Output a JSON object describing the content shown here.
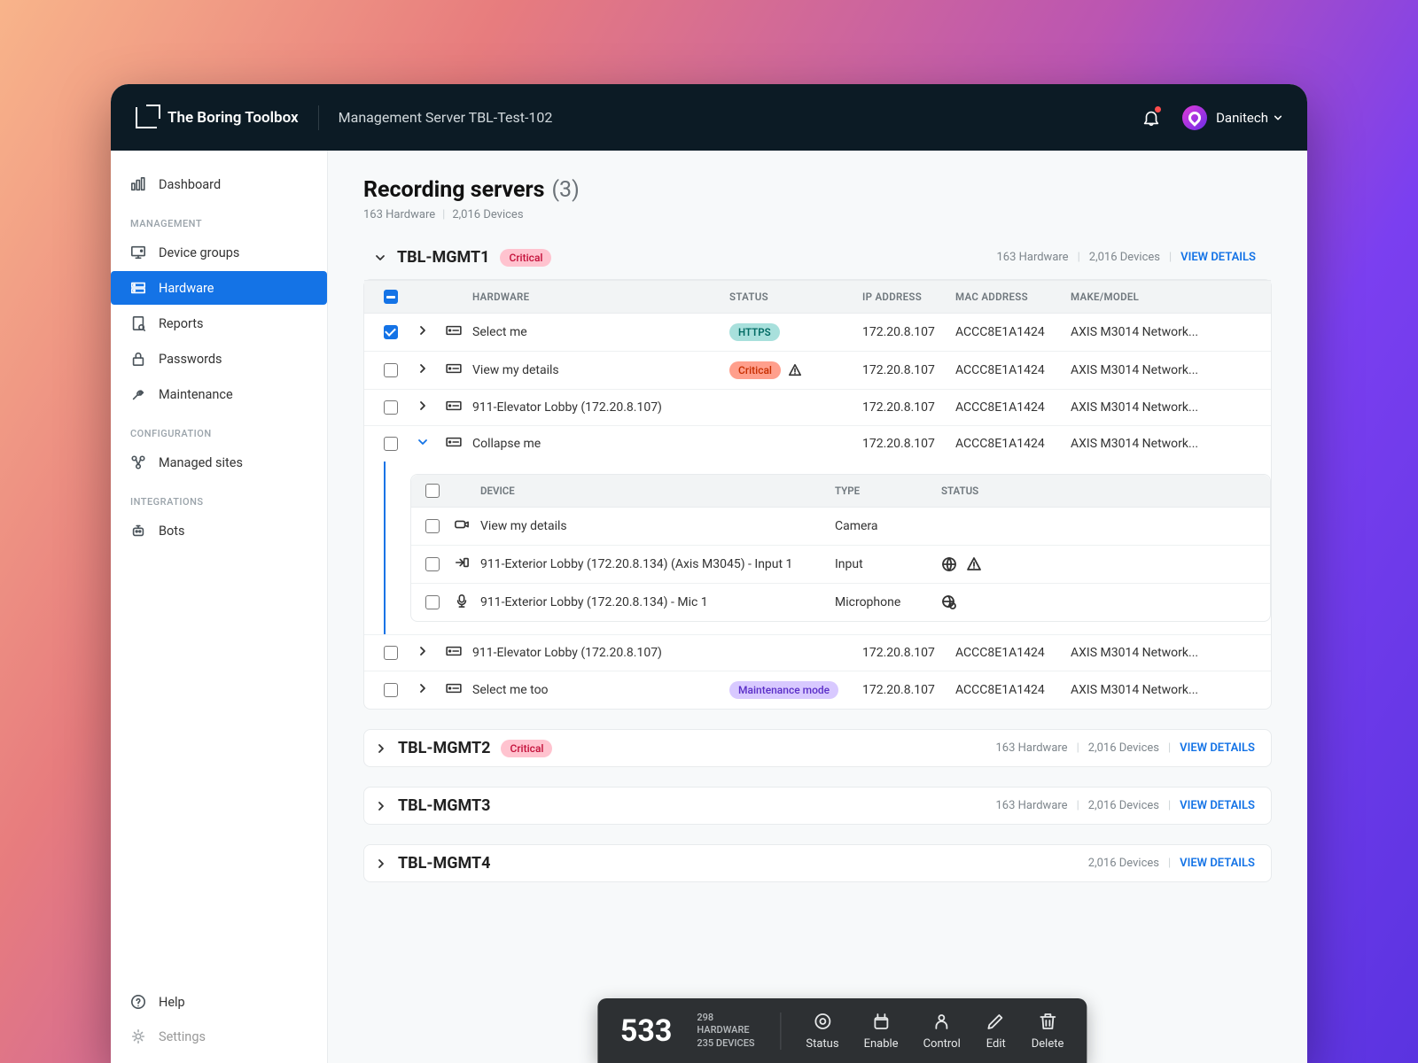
{
  "header": {
    "brand": "The Boring Toolbox",
    "subtitle": "Management Server TBL-Test-102",
    "user": "Danitech"
  },
  "sidebar": {
    "items": {
      "dashboard": "Dashboard",
      "device_groups": "Device groups",
      "hardware": "Hardware",
      "reports": "Reports",
      "passwords": "Passwords",
      "maintenance": "Maintenance",
      "managed_sites": "Managed sites",
      "bots": "Bots",
      "help": "Help",
      "settings": "Settings"
    },
    "sections": {
      "management": "MANAGEMENT",
      "configuration": "CONFIGURATION",
      "integrations": "INTEGRATIONS"
    }
  },
  "page": {
    "title": "Recording servers",
    "count": "(3)",
    "hw": "163 Hardware",
    "dev": "2,016 Devices"
  },
  "view_details": "VIEW DETAILS",
  "srv1": {
    "name": "TBL-MGMT1",
    "badge": "Critical",
    "hw": "163 Hardware",
    "dev": "2,016 Devices",
    "cols": {
      "hardware": "HARDWARE",
      "status": "STATUS",
      "ip": "IP ADDRESS",
      "mac": "MAC ADDRESS",
      "model": "MAKE/MODEL"
    },
    "rows": [
      {
        "name": "Select me",
        "status": "HTTPS",
        "ip": "172.20.8.107",
        "mac": "ACCC8E1A1424",
        "model": "AXIS M3014 Network..."
      },
      {
        "name": "View my details",
        "status": "Critical",
        "ip": "172.20.8.107",
        "mac": "ACCC8E1A1424",
        "model": "AXIS M3014 Network..."
      },
      {
        "name": "911-Elevator Lobby (172.20.8.107)",
        "status": "",
        "ip": "172.20.8.107",
        "mac": "ACCC8E1A1424",
        "model": "AXIS M3014 Network..."
      },
      {
        "name": "Collapse me",
        "status": "",
        "ip": "172.20.8.107",
        "mac": "ACCC8E1A1424",
        "model": "AXIS M3014 Network..."
      },
      {
        "name": "911-Elevator Lobby (172.20.8.107)",
        "status": "",
        "ip": "172.20.8.107",
        "mac": "ACCC8E1A1424",
        "model": "AXIS M3014 Network..."
      },
      {
        "name": "Select me too",
        "status": "Maintenance mode",
        "ip": "172.20.8.107",
        "mac": "ACCC8E1A1424",
        "model": "AXIS M3014 Network..."
      }
    ],
    "sub": {
      "cols": {
        "device": "DEVICE",
        "type": "TYPE",
        "status": "STATUS"
      },
      "rows": [
        {
          "name": "View my details",
          "type": "Camera"
        },
        {
          "name": "911-Exterior Lobby (172.20.8.134) (Axis M3045) - Input 1",
          "type": "Input"
        },
        {
          "name": "911-Exterior Lobby (172.20.8.134) - Mic 1",
          "type": "Microphone"
        }
      ]
    }
  },
  "srv2": {
    "name": "TBL-MGMT2",
    "badge": "Critical",
    "hw": "163 Hardware",
    "dev": "2,016 Devices"
  },
  "srv3": {
    "name": "TBL-MGMT3",
    "hw": "163 Hardware",
    "dev": "2,016 Devices"
  },
  "srv4": {
    "name": "TBL-MGMT4",
    "dev": "2,016 Devices"
  },
  "floatbar": {
    "count": "533",
    "hw": "298 HARDWARE",
    "dev": "235 DEVICES",
    "btns": {
      "status": "Status",
      "enable": "Enable",
      "control": "Control",
      "edit": "Edit",
      "delete": "Delete"
    }
  }
}
